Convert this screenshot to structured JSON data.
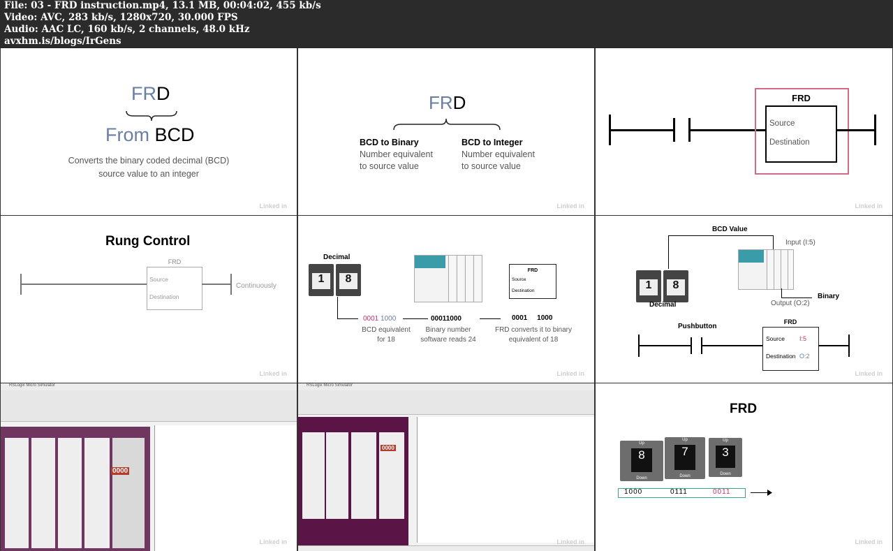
{
  "header": {
    "file_line": "File: 03 - FRD instruction.mp4, 13.1 MB, 00:04:02, 455 kb/s",
    "video_line": "Video: AVC, 283 kb/s, 1280x720, 30.000 FPS",
    "audio_line": "Audio: AAC LC, 160 kb/s, 2 channels, 48.0 kHz",
    "source_line": "avxhm.is/blogs/IrGens"
  },
  "watermark": "Linked in",
  "frame1": {
    "fr": "FR",
    "d": "D",
    "from": "From ",
    "bcd": "BCD",
    "desc_1": "Converts the binary coded decimal (BCD)",
    "desc_2": "source value to an integer"
  },
  "frame2": {
    "fr": "FR",
    "d": "D",
    "left_title": "BCD to Binary",
    "left_1": "Number equivalent",
    "left_2": "to source value",
    "right_title": "BCD to Integer",
    "right_1": "Number equivalent",
    "right_2": "to source value"
  },
  "frame3": {
    "title": "FRD",
    "source": "Source",
    "destination": "Destination"
  },
  "frame4": {
    "heading": "Rung Control",
    "box_title": "FRD",
    "source": "Source",
    "destination": "Destination",
    "continuously": "Continuously"
  },
  "frame5": {
    "decimal": "Decimal",
    "digit_1": "1",
    "digit_8": "8",
    "bcd_a": "0001",
    "bcd_b": "1000",
    "bcd_caption_1": "BCD equivalent",
    "bcd_caption_2": "for 18",
    "binary": "00011000",
    "binary_caption_1": "Binary number",
    "binary_caption_2": "software reads 24",
    "frd_title": "FRD",
    "frd_source": "Source",
    "frd_destination": "Destination",
    "frd_a": "0001",
    "frd_b": "1000",
    "frd_caption_1": "FRD converts it to binary",
    "frd_caption_2": "equivalent of 18"
  },
  "frame6": {
    "bcd_value": "BCD Value",
    "input": "Input (I:5)",
    "binary": "Binary",
    "output": "Output (O:2)",
    "decimal": "Decimal",
    "digit_1": "1",
    "digit_8": "8",
    "pushbutton": "Pushbutton",
    "frd_title": "FRD",
    "source": "Source",
    "source_val": "I:5",
    "destination": "Destination",
    "destination_val": "O:2"
  },
  "frame7": {
    "title": "RSLogix Micro Simulator",
    "display": "0000"
  },
  "frame8": {
    "title": "RSLogix Micro Simulator",
    "display": "0000"
  },
  "frame9": {
    "title": "FRD",
    "up": "Up",
    "down": "Down",
    "digits": [
      "8",
      "7",
      "3"
    ],
    "codes": [
      "1000",
      "0111",
      "0011"
    ]
  },
  "colors": {
    "accent_pink": "#c5306a",
    "accent_blue": "#6a7ea3",
    "plc_teal": "#3a9ca8",
    "sim_purple": "#5a1546"
  }
}
